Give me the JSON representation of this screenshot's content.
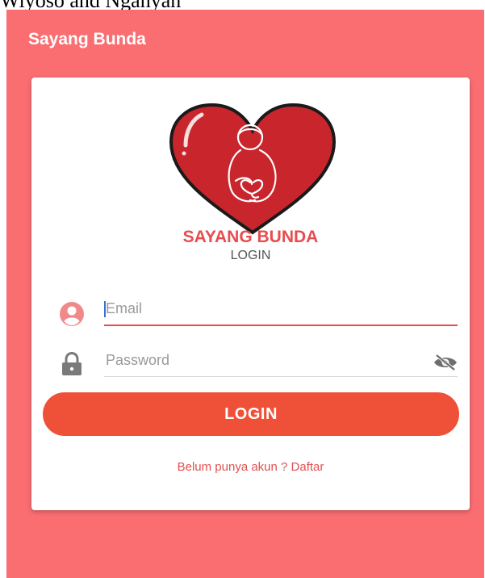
{
  "page": {
    "top_caption": "Wiyoso and Nganyan"
  },
  "appbar": {
    "title": "Sayang Bunda"
  },
  "card": {
    "brand": "SAYANG BUNDA",
    "subtitle": "LOGIN"
  },
  "form": {
    "email_placeholder": "Email",
    "password_placeholder": "Password",
    "login_label": "LOGIN",
    "register_text": "Belum punya akun ? Daftar"
  },
  "colors": {
    "background": "#fa6e72",
    "accent": "#ef5038",
    "brand_text": "#e74c4f",
    "heart": "#c8262c"
  },
  "icons": {
    "logo": "heart-pregnant-mother-logo",
    "email": "user-icon",
    "password": "lock-icon",
    "visibility": "eye-off-icon"
  }
}
